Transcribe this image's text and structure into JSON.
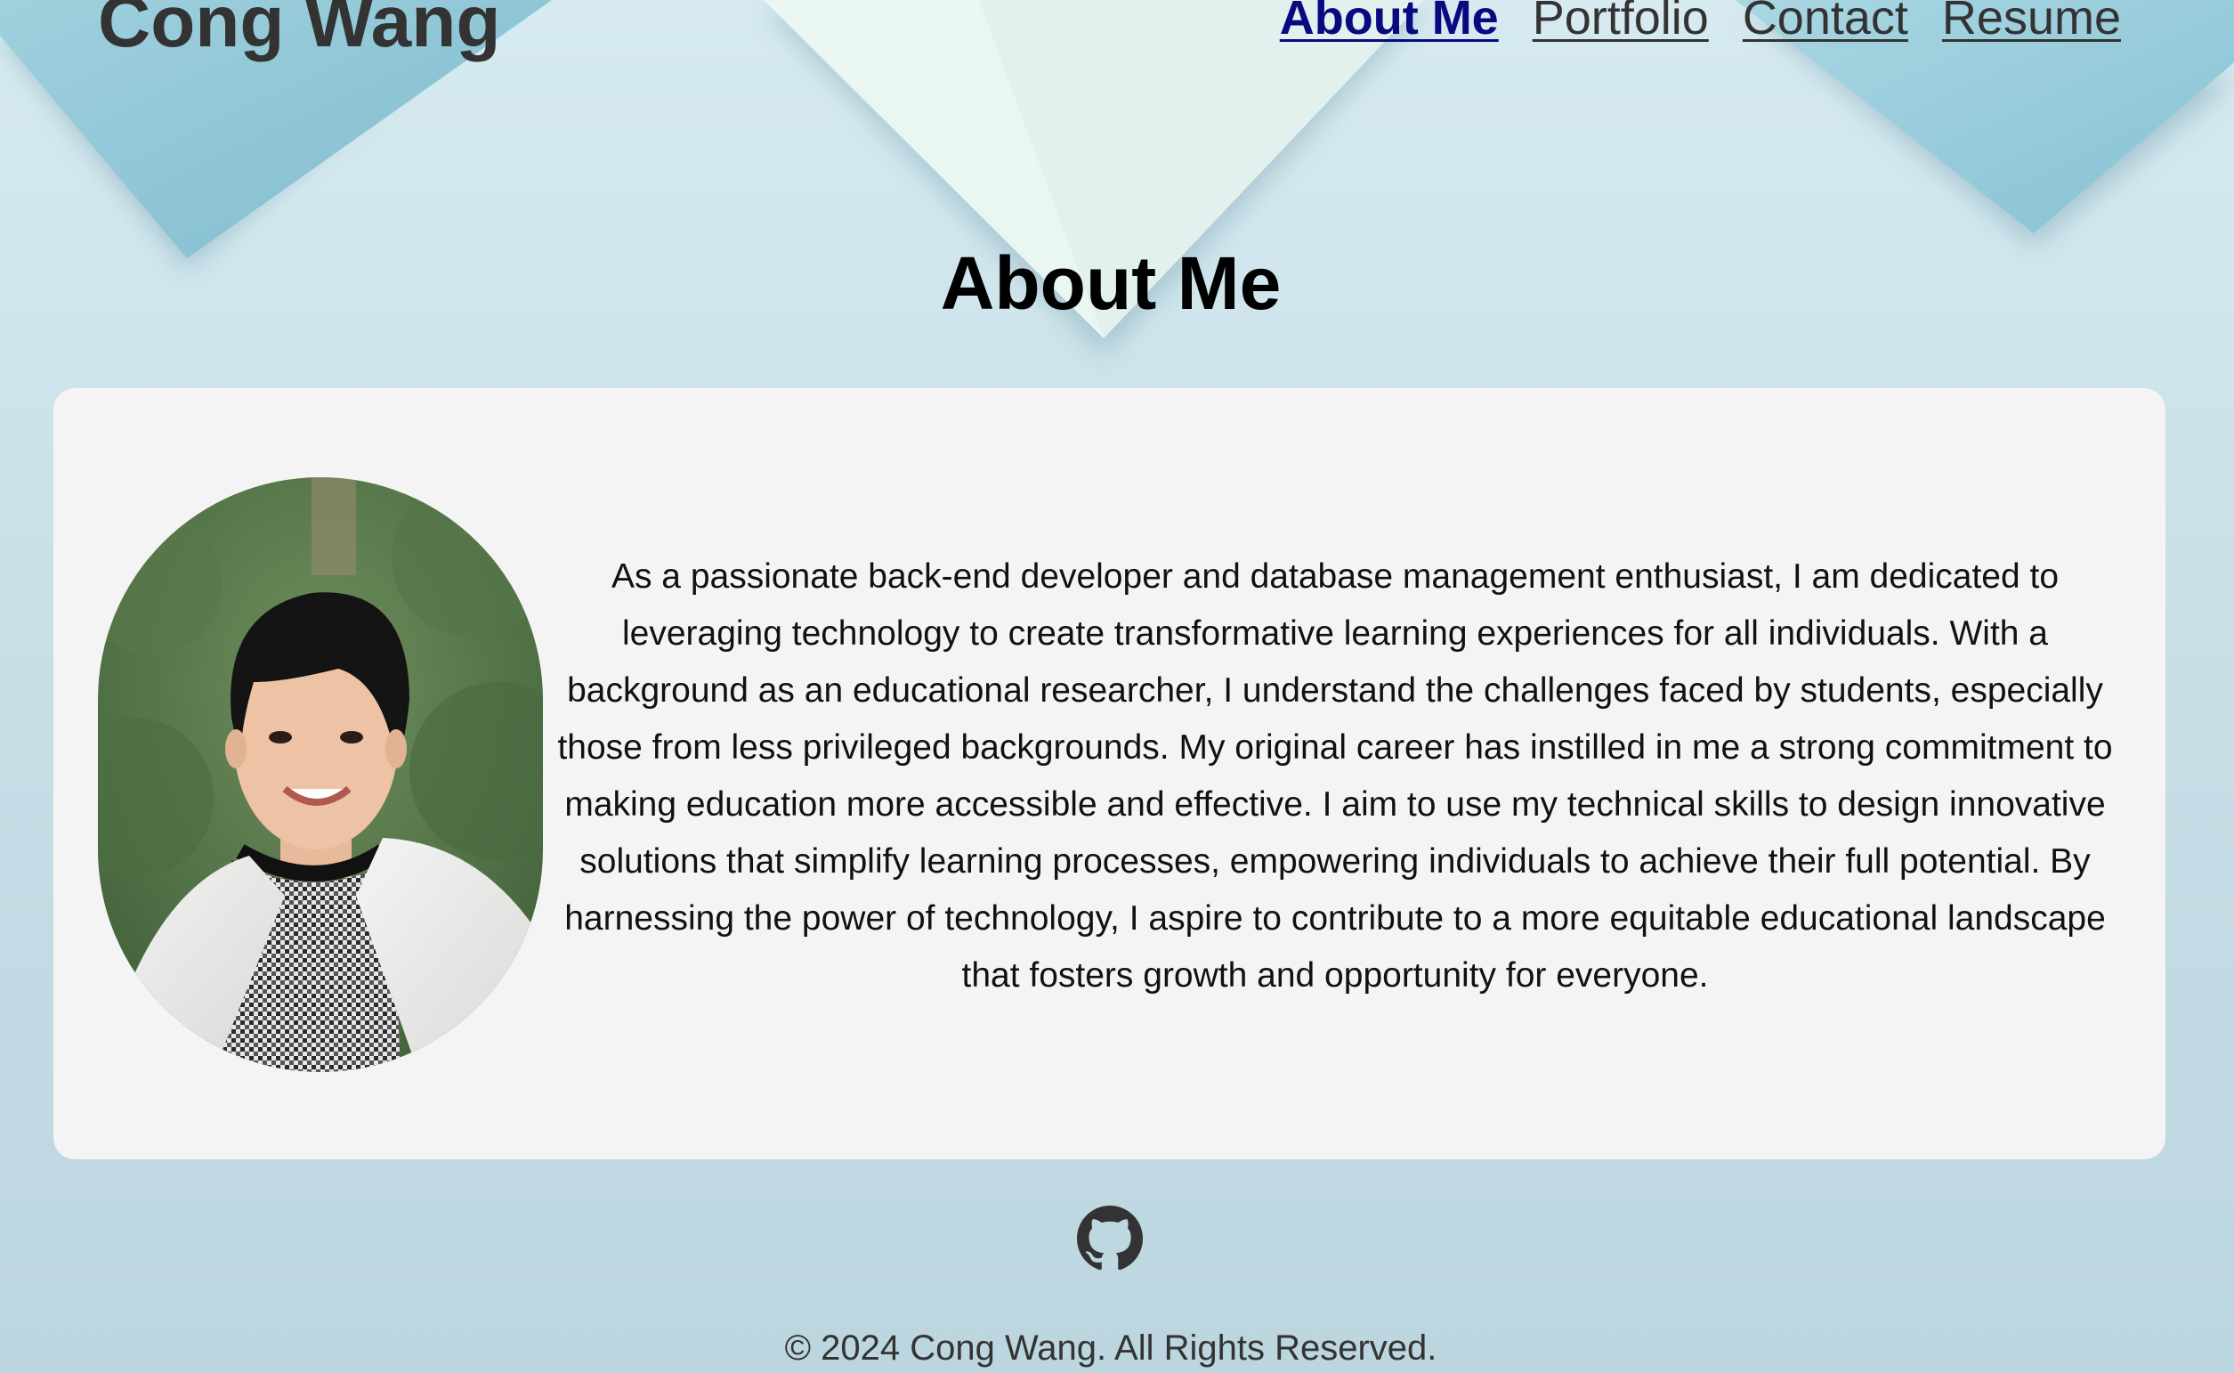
{
  "header": {
    "site_title": "Cong Wang",
    "nav": [
      {
        "label": "About Me",
        "active": true
      },
      {
        "label": "Portfolio",
        "active": false
      },
      {
        "label": "Contact",
        "active": false
      },
      {
        "label": "Resume",
        "active": false
      }
    ]
  },
  "about": {
    "heading": "About Me",
    "portrait_icon": "profile-photo",
    "bio": "As a passionate back-end developer and database management enthusiast, I am dedicated to leveraging technology to create transformative learning experiences for all individuals. With a background as an educational researcher, I understand the challenges faced by students, especially those from less privileged backgrounds. My original career has instilled in me a strong commitment to making education more accessible and effective. I aim to use my technical skills to design innovative solutions that simplify learning processes, empowering individuals to achieve their full potential. By harnessing the power of technology, I aspire to contribute to a more equitable educational landscape that fosters growth and opportunity for everyone."
  },
  "footer": {
    "social_icon": "github-icon",
    "copyright": "© 2024 Cong Wang. All Rights Reserved."
  },
  "colors": {
    "background": "#c9e0e8",
    "card": "#f4f4f4",
    "text": "#333333",
    "active_link": "#0a0a80"
  }
}
